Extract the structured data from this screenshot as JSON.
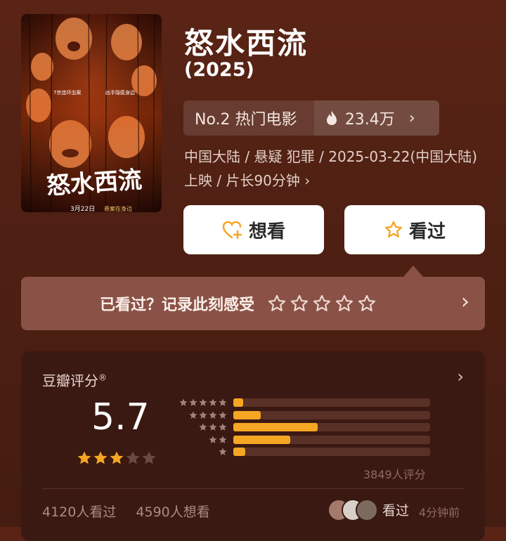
{
  "movie": {
    "title": "怒水西流",
    "year": "(2025)",
    "rank_label": "No.2 热门电影",
    "heat": "23.4万",
    "info_line1": "中国大陆 / 悬疑 犯罪 / 2025-03-22(中国大陆)",
    "info_line2": "上映 / 片长90分钟 ›"
  },
  "poster": {
    "title_art": "怒水西流",
    "tagline_left": "7宗连环血案",
    "tagline_right": "凶手隐匿身边",
    "release_text": "3月22日",
    "release_sub": "悬案在身边"
  },
  "actions": {
    "want_label": "想看",
    "watched_label": "看过"
  },
  "record": {
    "prompt": "已看过？记录此刻感受"
  },
  "rating": {
    "title": "豆瓣评分",
    "score": "5.7",
    "stars_filled": 3,
    "stars_total": 5,
    "distribution": [
      0.05,
      0.14,
      0.43,
      0.29,
      0.06
    ],
    "count_text": "3849人评分",
    "watched_count": "4120人看过",
    "want_count": "4590人想看",
    "friend_status": "看过",
    "friend_time": "4分钟前"
  },
  "colors": {
    "accent": "#f5a623",
    "record_bg": "#8a5246",
    "card_bg": "#3a1912"
  }
}
